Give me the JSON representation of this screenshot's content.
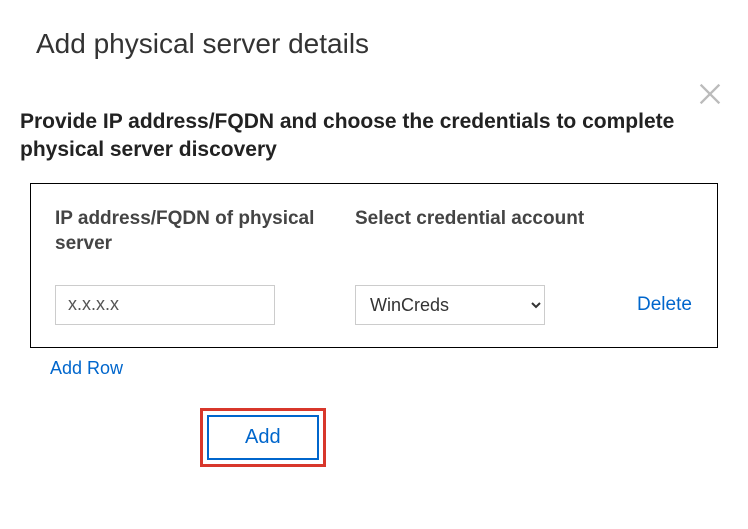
{
  "title": "Add physical server details",
  "description": "Provide IP address/FQDN and choose the credentials to complete physical server discovery",
  "columns": {
    "ip": "IP address/FQDN of physical server",
    "cred": "Select credential account"
  },
  "row": {
    "ip_value": "x.x.x.x",
    "cred_selected": "WinCreds",
    "delete_label": "Delete"
  },
  "add_row_label": "Add Row",
  "add_button_label": "Add"
}
